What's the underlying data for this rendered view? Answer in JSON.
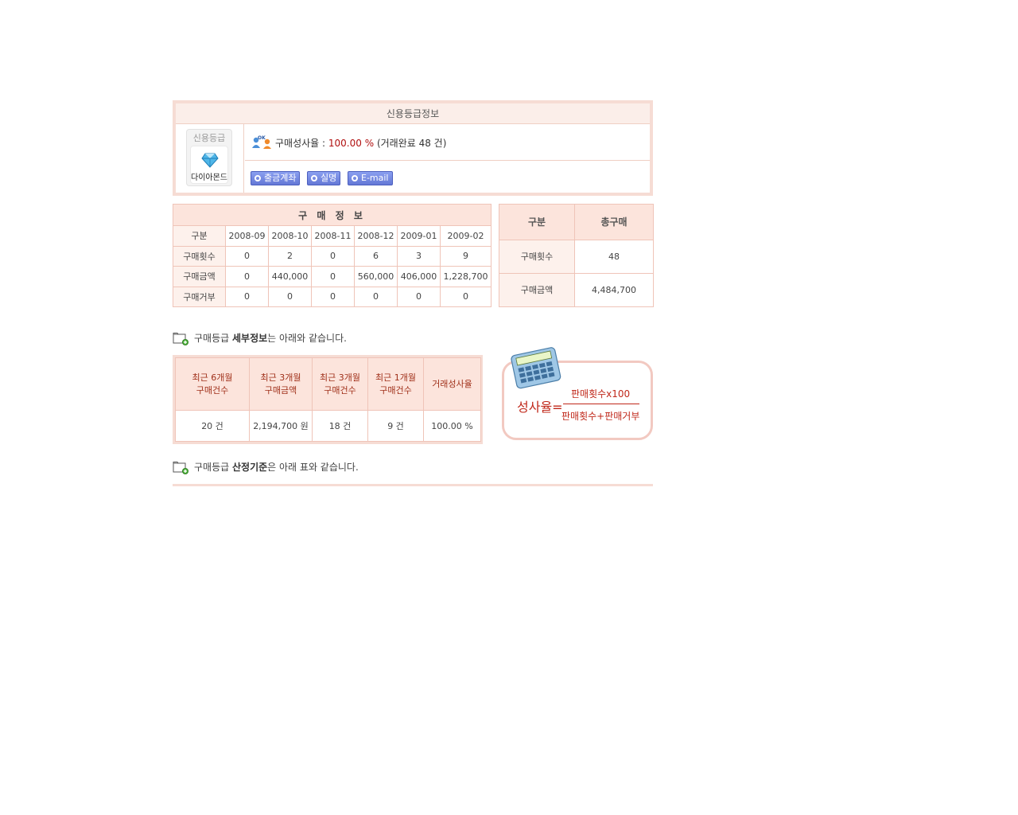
{
  "credit": {
    "title": "신용등급정보",
    "grade_label": "신용등급",
    "grade_name": "다이아몬드",
    "rate_prefix": "구매성사율 :",
    "rate_value": "100.00 %",
    "rate_suffix": "(거래완료 48 건)",
    "buttons": {
      "account": "출금계좌",
      "realname": "실명",
      "email": "E-mail"
    }
  },
  "purchase": {
    "title": "구 매 정 보",
    "corner": "구분",
    "months": [
      "2008-09",
      "2008-10",
      "2008-11",
      "2008-12",
      "2009-01",
      "2009-02"
    ],
    "rows": [
      {
        "label": "구매횟수",
        "values": [
          "0",
          "2",
          "0",
          "6",
          "3",
          "9"
        ]
      },
      {
        "label": "구매금액",
        "values": [
          "0",
          "440,000",
          "0",
          "560,000",
          "406,000",
          "1,228,700"
        ]
      },
      {
        "label": "구매거부",
        "values": [
          "0",
          "0",
          "0",
          "0",
          "0",
          "0"
        ]
      }
    ]
  },
  "total": {
    "col1": "구분",
    "col2": "총구매",
    "rows": [
      {
        "label": "구매횟수",
        "value": "48"
      },
      {
        "label": "구매금액",
        "value": "4,484,700"
      }
    ]
  },
  "detail_heading": {
    "pre": "구매등급 ",
    "bold": "세부정보",
    "post": "는 아래와 같습니다."
  },
  "detail": {
    "headers": [
      [
        "최근 6개월",
        "구매건수"
      ],
      [
        "최근 3개월",
        "구매금액"
      ],
      [
        "최근 3개월",
        "구매건수"
      ],
      [
        "최근 1개월",
        "구매건수"
      ],
      [
        "거래성사율",
        ""
      ]
    ],
    "values": [
      "20 건",
      "2,194,700 원",
      "18 건",
      "9 건",
      "100.00 %"
    ]
  },
  "formula": {
    "left": "성사율=",
    "numerator": "판매횟수x100",
    "denominator": "판매횟수+판매거부"
  },
  "criteria_heading": {
    "pre": "구매등급 ",
    "bold": "산정기준",
    "post": "은 아래 표와 같습니다."
  },
  "colors": {
    "accent_red": "#b01010",
    "table_border": "#efc4b8",
    "header_bg": "#fce4dc",
    "button_blue": "#6478d6"
  }
}
